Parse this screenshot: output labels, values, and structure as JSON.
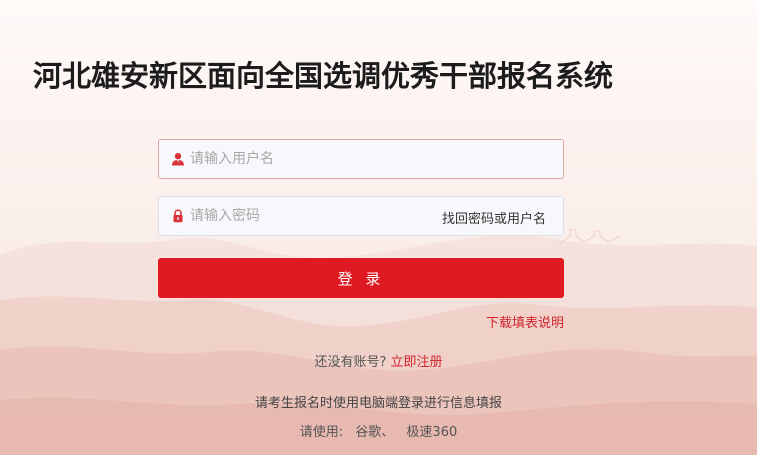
{
  "page": {
    "title": "河北雄安新区面向全国选调优秀干部报名系统"
  },
  "form": {
    "username_placeholder": "请输入用户名",
    "password_placeholder": "请输入密码",
    "recover_link": "找回密码或用户名",
    "login_button": "登 录",
    "download_link": "下载填表说明"
  },
  "register": {
    "prompt": "还没有账号?",
    "link": "立即注册"
  },
  "notice": "请考生报名时使用电脑端登录进行信息填报",
  "browser_tip": {
    "label": "请使用:",
    "browsers": [
      "谷歌、",
      "极速360"
    ]
  },
  "colors": {
    "accent": "#e01a22",
    "link_red": "#d0232b",
    "icon_red": "#d9333a",
    "title": "#1c1c1c"
  },
  "icons": {
    "username": "user-icon",
    "password": "lock-icon"
  }
}
